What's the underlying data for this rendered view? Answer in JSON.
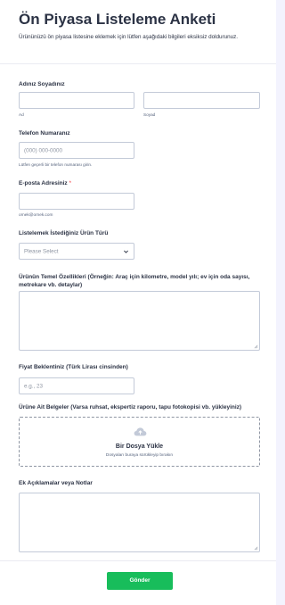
{
  "header": {
    "title": "Ön Piyasa Listeleme Anketi",
    "subtitle": "Ürününüzü ön piyasa listesine eklemek için lütfen aşağıdaki bilgileri eksiksiz doldurunuz."
  },
  "name": {
    "label": "Adınız Soyadınız",
    "first_sublabel": "Ad",
    "last_sublabel": "Soyad"
  },
  "phone": {
    "label": "Telefon Numaranız",
    "placeholder": "(000) 000-0000",
    "hint": "Lütfen geçerli bir telefon numarası girin."
  },
  "email": {
    "label": "E-posta Adresiniz",
    "required_mark": "*",
    "hint": "ornek@ornek.com"
  },
  "product_type": {
    "label": "Listelemek İstediğiniz Ürün Türü",
    "selected": "Please Select"
  },
  "features": {
    "label": "Ürünün Temel Özellikleri (Örneğin: Araç için kilometre, model yılı; ev için oda sayısı, metrekare vb. detaylar)"
  },
  "price": {
    "label": "Fiyat Beklentiniz (Türk Lirası cinsinden)",
    "placeholder": "e.g., 23"
  },
  "documents": {
    "label": "Ürüne Ait Belgeler (Varsa ruhsat, ekspertiz raporu, tapu fotokopisi vb. yükleyiniz)",
    "upload_title": "Bir Dosya Yükle",
    "upload_hint": "Dosyaları buraya sürükleyip bırakın",
    "icon": "cloud-upload-icon"
  },
  "notes": {
    "label": "Ek Açıklamalar veya Notlar"
  },
  "submit": {
    "label": "Gönder",
    "color": "#18bd5b"
  },
  "colors": {
    "text": "#2c3345",
    "border": "#c3cad8",
    "required": "#f23a3c"
  }
}
